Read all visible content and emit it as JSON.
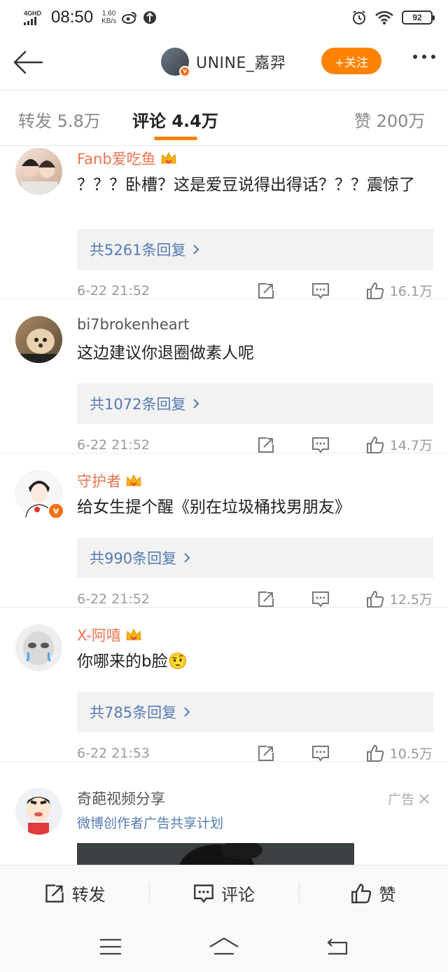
{
  "status_bar": {
    "network": "4GHD",
    "time": "08:50",
    "speed_value": "1.60",
    "speed_unit": "KB/s",
    "battery": "92"
  },
  "nav": {
    "username": "UNINE_嘉羿",
    "follow_label": "+关注"
  },
  "tabs": [
    {
      "label": "转发 5.8万",
      "active": false
    },
    {
      "label": "评论 4.4万",
      "active": true
    },
    {
      "label": "赞 200万",
      "active": false
    }
  ],
  "comments": [
    {
      "name": "Fanb爱吃鱼",
      "vip": true,
      "text": "？？？卧槽？这是爱豆说得出得话？？？震惊了",
      "replies": "共5261条回复",
      "time": "6-22 21:52",
      "likes": "16.1万"
    },
    {
      "name": "bi7brokenheart",
      "vip": false,
      "text": "这边建议你退圈做素人呢",
      "replies": "共1072条回复",
      "time": "6-22 21:52",
      "likes": "14.7万"
    },
    {
      "name": "守护者",
      "vip": true,
      "text": "给女生提个醒《别在垃圾桶找男朋友》",
      "replies": "共990条回复",
      "time": "6-22 21:52",
      "likes": "12.5万"
    },
    {
      "name": "X-阿嘻",
      "vip": true,
      "text": "你哪来的b脸🤨",
      "replies": "共785条回复",
      "time": "6-22 21:53",
      "likes": "10.5万"
    }
  ],
  "ad": {
    "name": "奇葩视频分享",
    "subtitle": "微博创作者广告共享计划",
    "tag": "广告"
  },
  "action_bar": {
    "repost": "转发",
    "comment": "评论",
    "like": "赞"
  },
  "colors": {
    "accent": "#ff8200",
    "link": "#557bb3",
    "vip_name": "#eb7350"
  }
}
